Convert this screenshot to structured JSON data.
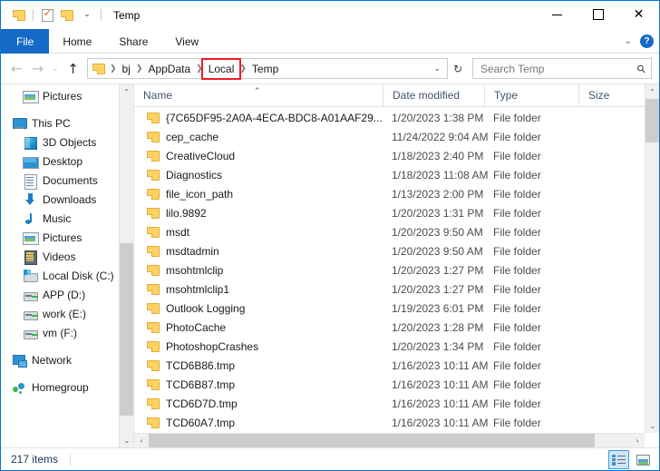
{
  "window": {
    "title": "Temp",
    "quick_access": [
      {
        "name": "folder-icon",
        "label": "Folder"
      },
      {
        "name": "properties-icon",
        "label": "Properties"
      },
      {
        "name": "new-folder-icon",
        "label": "New folder"
      },
      {
        "name": "chevron-down-icon",
        "label": "Customize Quick Access Toolbar"
      }
    ],
    "controls": {
      "minimize": "Minimize",
      "maximize": "Maximize",
      "close": "Close",
      "close_glyph": "✕"
    }
  },
  "ribbon": {
    "tabs": [
      {
        "label": "File"
      },
      {
        "label": "Home"
      },
      {
        "label": "Share"
      },
      {
        "label": "View"
      }
    ],
    "collapse_glyph": "⌄",
    "help_glyph": "?"
  },
  "navigation": {
    "back": "←",
    "forward": "→",
    "recent": "⌄",
    "up": "↑",
    "refresh_glyph": "↻",
    "crumb_separator": "❯",
    "dropdown_glyph": "⌄",
    "breadcrumbs": [
      {
        "label": "bj",
        "highlighted": false
      },
      {
        "label": "AppData",
        "highlighted": false
      },
      {
        "label": "Local",
        "highlighted": true
      },
      {
        "label": "Temp",
        "highlighted": false
      }
    ],
    "highlight_color": "#ee1c25"
  },
  "search": {
    "placeholder": "Search Temp",
    "value": "",
    "icon_glyph": "⚲"
  },
  "sidebar": {
    "scroll_up_glyph": "⌃",
    "scroll_down_glyph": "⌄",
    "items": [
      {
        "label": "Pictures",
        "icon": "pictures-icon",
        "indent": 1,
        "gap_before": false
      },
      {
        "label": "This PC",
        "icon": "this-pc-icon",
        "indent": 0,
        "gap_before": true
      },
      {
        "label": "3D Objects",
        "icon": "3d-objects-icon",
        "indent": 1,
        "gap_before": false
      },
      {
        "label": "Desktop",
        "icon": "desktop-icon",
        "indent": 1,
        "gap_before": false
      },
      {
        "label": "Documents",
        "icon": "documents-icon",
        "indent": 1,
        "gap_before": false
      },
      {
        "label": "Downloads",
        "icon": "downloads-icon",
        "indent": 1,
        "gap_before": false
      },
      {
        "label": "Music",
        "icon": "music-icon",
        "indent": 1,
        "gap_before": false
      },
      {
        "label": "Pictures",
        "icon": "pictures-icon",
        "indent": 1,
        "gap_before": false
      },
      {
        "label": "Videos",
        "icon": "videos-icon",
        "indent": 1,
        "gap_before": false
      },
      {
        "label": "Local Disk (C:)",
        "icon": "local-disk-icon",
        "indent": 1,
        "gap_before": false
      },
      {
        "label": "APP (D:)",
        "icon": "drive-icon",
        "indent": 1,
        "gap_before": false
      },
      {
        "label": "work (E:)",
        "icon": "drive-icon",
        "indent": 1,
        "gap_before": false
      },
      {
        "label": "vm (F:)",
        "icon": "drive-icon",
        "indent": 1,
        "gap_before": false
      },
      {
        "label": "Network",
        "icon": "network-icon",
        "indent": 0,
        "gap_before": true
      },
      {
        "label": "Homegroup",
        "icon": "homegroup-icon",
        "indent": 0,
        "gap_before": true
      }
    ]
  },
  "filelist": {
    "columns": [
      {
        "label": "Name",
        "key": "name"
      },
      {
        "label": "Date modified",
        "key": "date"
      },
      {
        "label": "Type",
        "key": "type"
      },
      {
        "label": "Size",
        "key": "size"
      }
    ],
    "sort_column": "Name",
    "sort_direction": "ascending",
    "sort_glyph": "⌃",
    "rows": [
      {
        "name": "{7C65DF95-2A0A-4ECA-BDC8-A01AAF29...",
        "date": "1/20/2023 1:38 PM",
        "type": "File folder",
        "size": ""
      },
      {
        "name": "cep_cache",
        "date": "11/24/2022 9:04 AM",
        "type": "File folder",
        "size": ""
      },
      {
        "name": "CreativeCloud",
        "date": "1/18/2023 2:40 PM",
        "type": "File folder",
        "size": ""
      },
      {
        "name": "Diagnostics",
        "date": "1/18/2023 11:08 AM",
        "type": "File folder",
        "size": ""
      },
      {
        "name": "file_icon_path",
        "date": "1/13/2023 2:00 PM",
        "type": "File folder",
        "size": ""
      },
      {
        "name": "lilo.9892",
        "date": "1/20/2023 1:31 PM",
        "type": "File folder",
        "size": ""
      },
      {
        "name": "msdt",
        "date": "1/20/2023 9:50 AM",
        "type": "File folder",
        "size": ""
      },
      {
        "name": "msdtadmin",
        "date": "1/20/2023 9:50 AM",
        "type": "File folder",
        "size": ""
      },
      {
        "name": "msohtmlclip",
        "date": "1/20/2023 1:27 PM",
        "type": "File folder",
        "size": ""
      },
      {
        "name": "msohtmlclip1",
        "date": "1/20/2023 1:27 PM",
        "type": "File folder",
        "size": ""
      },
      {
        "name": "Outlook Logging",
        "date": "1/19/2023 6:01 PM",
        "type": "File folder",
        "size": ""
      },
      {
        "name": "PhotoCache",
        "date": "1/20/2023 1:28 PM",
        "type": "File folder",
        "size": ""
      },
      {
        "name": "PhotoshopCrashes",
        "date": "1/20/2023 1:34 PM",
        "type": "File folder",
        "size": ""
      },
      {
        "name": "TCD6B86.tmp",
        "date": "1/16/2023 10:11 AM",
        "type": "File folder",
        "size": ""
      },
      {
        "name": "TCD6B87.tmp",
        "date": "1/16/2023 10:11 AM",
        "type": "File folder",
        "size": ""
      },
      {
        "name": "TCD6D7D.tmp",
        "date": "1/16/2023 10:11 AM",
        "type": "File folder",
        "size": ""
      },
      {
        "name": "TCD60A7.tmp",
        "date": "1/16/2023 10:11 AM",
        "type": "File folder",
        "size": ""
      }
    ],
    "hscroll_left_glyph": "‹",
    "hscroll_right_glyph": "›",
    "vscroll_up_glyph": "⌃",
    "vscroll_down_glyph": "⌄"
  },
  "statusbar": {
    "item_count": "217 items",
    "views": [
      {
        "name": "details-view-button",
        "label": "Details view",
        "active": true
      },
      {
        "name": "large-icons-view-button",
        "label": "Large icons view",
        "active": false
      }
    ]
  }
}
